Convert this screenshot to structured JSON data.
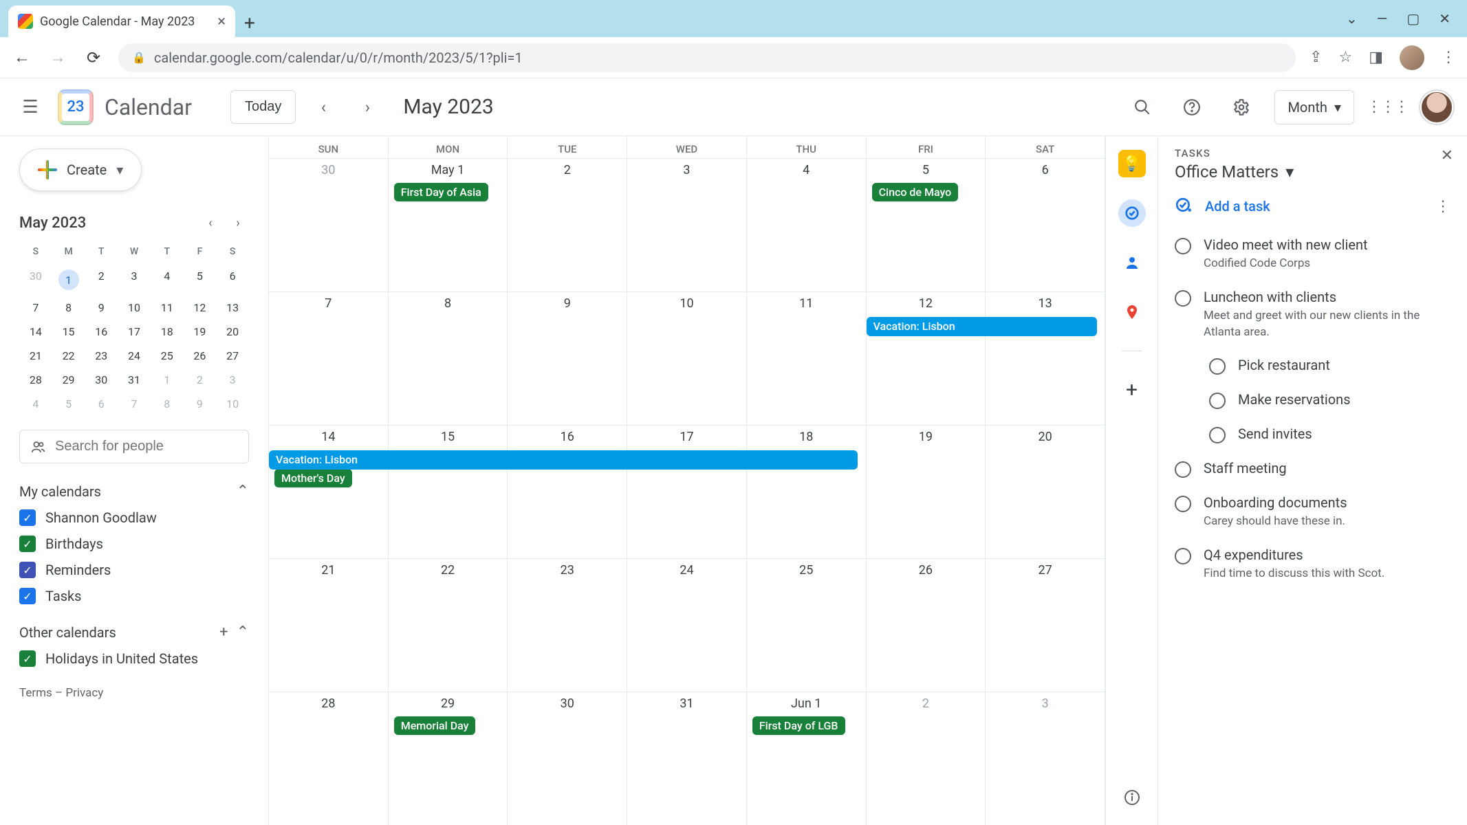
{
  "browser": {
    "tab_title": "Google Calendar - May 2023",
    "url": "calendar.google.com/calendar/u/0/r/month/2023/5/1?pli=1"
  },
  "header": {
    "app_title": "Calendar",
    "logo_day": "23",
    "today_label": "Today",
    "current_period": "May 2023",
    "view_label": "Month"
  },
  "sidebar": {
    "create_label": "Create",
    "mini_title": "May 2023",
    "dow": [
      "S",
      "M",
      "T",
      "W",
      "T",
      "F",
      "S"
    ],
    "mini_weeks": [
      [
        {
          "n": "30",
          "dim": true
        },
        {
          "n": "1",
          "sel": true
        },
        {
          "n": "2"
        },
        {
          "n": "3"
        },
        {
          "n": "4"
        },
        {
          "n": "5"
        },
        {
          "n": "6"
        }
      ],
      [
        {
          "n": "7"
        },
        {
          "n": "8"
        },
        {
          "n": "9"
        },
        {
          "n": "10"
        },
        {
          "n": "11"
        },
        {
          "n": "12"
        },
        {
          "n": "13"
        }
      ],
      [
        {
          "n": "14"
        },
        {
          "n": "15"
        },
        {
          "n": "16"
        },
        {
          "n": "17"
        },
        {
          "n": "18"
        },
        {
          "n": "19"
        },
        {
          "n": "20"
        }
      ],
      [
        {
          "n": "21"
        },
        {
          "n": "22"
        },
        {
          "n": "23"
        },
        {
          "n": "24"
        },
        {
          "n": "25"
        },
        {
          "n": "26"
        },
        {
          "n": "27"
        }
      ],
      [
        {
          "n": "28"
        },
        {
          "n": "29"
        },
        {
          "n": "30"
        },
        {
          "n": "31"
        },
        {
          "n": "1",
          "dim": true
        },
        {
          "n": "2",
          "dim": true
        },
        {
          "n": "3",
          "dim": true
        }
      ],
      [
        {
          "n": "4",
          "dim": true
        },
        {
          "n": "5",
          "dim": true
        },
        {
          "n": "6",
          "dim": true
        },
        {
          "n": "7",
          "dim": true
        },
        {
          "n": "8",
          "dim": true
        },
        {
          "n": "9",
          "dim": true
        },
        {
          "n": "10",
          "dim": true
        }
      ]
    ],
    "search_placeholder": "Search for people",
    "my_cal_label": "My calendars",
    "my_cals": [
      {
        "label": "Shannon Goodlaw",
        "color": "#1a73e8"
      },
      {
        "label": "Birthdays",
        "color": "#188038"
      },
      {
        "label": "Reminders",
        "color": "#3f51b5"
      },
      {
        "label": "Tasks",
        "color": "#1a73e8"
      }
    ],
    "other_cal_label": "Other calendars",
    "other_cals": [
      {
        "label": "Holidays in United States",
        "color": "#188038"
      }
    ],
    "terms": "Terms",
    "privacy": "Privacy"
  },
  "grid": {
    "dow": [
      "SUN",
      "MON",
      "TUE",
      "WED",
      "THU",
      "FRI",
      "SAT"
    ],
    "weeks": [
      {
        "days": [
          {
            "n": "30",
            "dim": true
          },
          {
            "n": "May 1"
          },
          {
            "n": "2"
          },
          {
            "n": "3"
          },
          {
            "n": "4"
          },
          {
            "n": "5"
          },
          {
            "n": "6"
          }
        ],
        "events": [
          {
            "col": 1,
            "label": "First Day of Asia",
            "cls": "green"
          },
          {
            "col": 5,
            "label": "Cinco de Mayo",
            "cls": "green"
          }
        ]
      },
      {
        "days": [
          {
            "n": "7"
          },
          {
            "n": "8"
          },
          {
            "n": "9"
          },
          {
            "n": "10"
          },
          {
            "n": "11"
          },
          {
            "n": "12"
          },
          {
            "n": "13"
          }
        ],
        "span": {
          "start": 5,
          "end": 7,
          "label": "Vacation: Lisbon",
          "cls": "blue"
        }
      },
      {
        "days": [
          {
            "n": "14"
          },
          {
            "n": "15"
          },
          {
            "n": "16"
          },
          {
            "n": "17"
          },
          {
            "n": "18"
          },
          {
            "n": "19"
          },
          {
            "n": "20"
          }
        ],
        "span": {
          "start": 0,
          "end": 5,
          "label": "Vacation: Lisbon",
          "cls": "blue"
        },
        "events": [
          {
            "col": 0,
            "label": "Mother's Day",
            "cls": "green",
            "offset": 30
          }
        ]
      },
      {
        "days": [
          {
            "n": "21"
          },
          {
            "n": "22"
          },
          {
            "n": "23"
          },
          {
            "n": "24"
          },
          {
            "n": "25"
          },
          {
            "n": "26"
          },
          {
            "n": "27"
          }
        ]
      },
      {
        "days": [
          {
            "n": "28"
          },
          {
            "n": "29"
          },
          {
            "n": "30"
          },
          {
            "n": "31"
          },
          {
            "n": "Jun 1"
          },
          {
            "n": "2",
            "dim": true
          },
          {
            "n": "3",
            "dim": true
          }
        ],
        "events": [
          {
            "col": 1,
            "label": "Memorial Day",
            "cls": "green"
          },
          {
            "col": 4,
            "label": "First Day of LGB",
            "cls": "green"
          }
        ]
      }
    ]
  },
  "tasks_panel": {
    "label": "TASKS",
    "list_title": "Office Matters",
    "add_label": "Add a task",
    "tasks": [
      {
        "title": "Video meet with new client",
        "desc": "Codified Code Corps"
      },
      {
        "title": "Luncheon with clients",
        "desc": "Meet and greet with our new clients in the Atlanta area.",
        "subs": [
          {
            "title": "Pick restaurant"
          },
          {
            "title": "Make reservations"
          },
          {
            "title": "Send invites"
          }
        ]
      },
      {
        "title": "Staff meeting"
      },
      {
        "title": "Onboarding documents",
        "desc": "Carey should have these in."
      },
      {
        "title": "Q4 expenditures",
        "desc": "Find time to discuss this with Scot."
      }
    ]
  }
}
